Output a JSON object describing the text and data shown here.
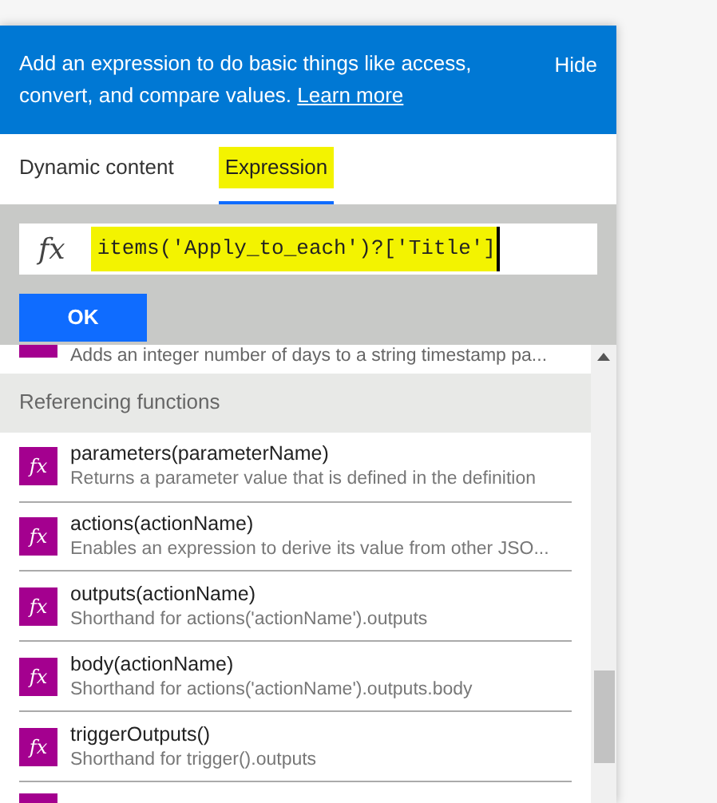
{
  "banner": {
    "text": "Add an expression to do basic things like access, convert, and compare values.",
    "link": "Learn more",
    "hide": "Hide"
  },
  "tabs": [
    {
      "label": "Dynamic content",
      "selected": false,
      "highlighted": false
    },
    {
      "label": "Expression",
      "selected": true,
      "highlighted": true
    }
  ],
  "expression": {
    "icon": "fx",
    "value": "items('Apply_to_each')?['Title']",
    "highlighted": true
  },
  "ok_button": "OK",
  "partial_row": {
    "description": "Adds an integer number of days to a string timestamp pa..."
  },
  "section": {
    "title": "Referencing functions"
  },
  "functions": [
    {
      "icon": "fx",
      "name": "parameters(parameterName)",
      "description": "Returns a parameter value that is defined in the definition"
    },
    {
      "icon": "fx",
      "name": "actions(actionName)",
      "description": "Enables an expression to derive its value from other JSO..."
    },
    {
      "icon": "fx",
      "name": "outputs(actionName)",
      "description": "Shorthand for actions('actionName').outputs"
    },
    {
      "icon": "fx",
      "name": "body(actionName)",
      "description": "Shorthand for actions('actionName').outputs.body"
    },
    {
      "icon": "fx",
      "name": "triggerOutputs()",
      "description": "Shorthand for trigger().outputs"
    }
  ]
}
